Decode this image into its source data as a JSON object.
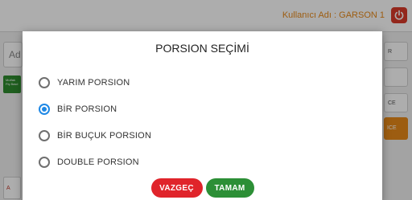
{
  "header": {
    "user_label": "Kullanıcı Adı : GARSON 1",
    "power_icon": "power-icon"
  },
  "background": {
    "field_text": "Ad",
    "green_card_text": "Mutfak Fiş Basıl",
    "right_button_1": "R",
    "right_button_2": "",
    "right_button_3": "CE",
    "right_button_4": "ICE",
    "bottom_card_text": "A"
  },
  "dialog": {
    "title": "PORSION SEÇİMİ",
    "options": [
      {
        "label": "YARIM PORSION",
        "checked": false
      },
      {
        "label": "BİR PORSION",
        "checked": true
      },
      {
        "label": "BİR BUÇUK PORSION",
        "checked": false
      },
      {
        "label": "DOUBLE PORSION",
        "checked": false
      }
    ],
    "cancel_label": "VAZGEÇ",
    "ok_label": "TAMAM"
  },
  "colors": {
    "accent_orange": "#e8891a",
    "radio_selected": "#1e88e5",
    "cancel_red": "#e0242b",
    "ok_green": "#2c8f36"
  }
}
